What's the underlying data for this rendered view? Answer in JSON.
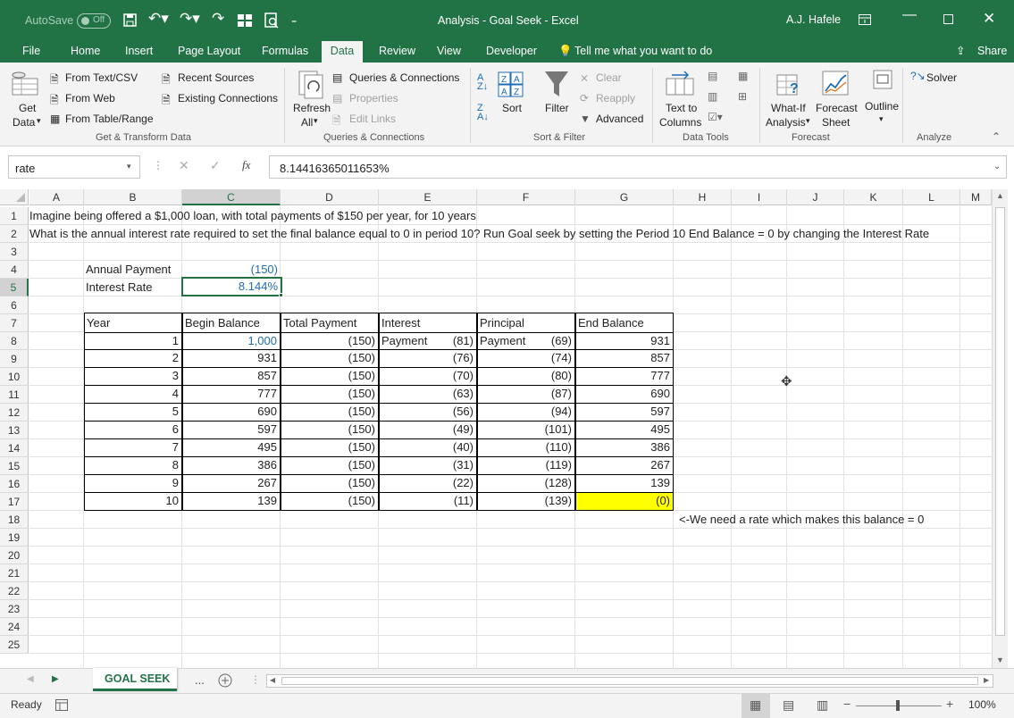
{
  "window": {
    "autosave": "AutoSave",
    "autosave_state": "Off",
    "title": "Analysis - Goal Seek  -  Excel",
    "user": "A.J. Hafele"
  },
  "tabs": [
    "File",
    "Home",
    "Insert",
    "Page Layout",
    "Formulas",
    "Data",
    "Review",
    "View",
    "Developer"
  ],
  "tell_me": "Tell me what you want to do",
  "share": "Share",
  "ribbon": {
    "get_data": "Get",
    "get_data2": "Data",
    "from_text": "From Text/CSV",
    "from_web": "From Web",
    "from_table": "From Table/Range",
    "recent_sources": "Recent Sources",
    "existing_connections": "Existing Connections",
    "refresh": "Refresh",
    "refresh2": "All",
    "queries": "Queries & Connections",
    "properties": "Properties",
    "edit_links": "Edit Links",
    "sort": "Sort",
    "filter": "Filter",
    "clear": "Clear",
    "reapply": "Reapply",
    "advanced": "Advanced",
    "text_to_columns": "Text to",
    "text_to_columns2": "Columns",
    "whatif": "What-If",
    "whatif2": "Analysis",
    "forecast": "Forecast",
    "forecast2": "Sheet",
    "outline": "Outline",
    "solver": "Solver",
    "groups": {
      "get_transform": "Get & Transform Data",
      "queries": "Queries & Connections",
      "sort_filter": "Sort & Filter",
      "data_tools": "Data Tools",
      "forecast": "Forecast",
      "analyze": "Analyze"
    }
  },
  "namebox": "rate",
  "formula": "8.14416365011653%",
  "columns": [
    "A",
    "B",
    "C",
    "D",
    "E",
    "F",
    "G",
    "H",
    "I",
    "J",
    "K",
    "L",
    "M"
  ],
  "rows": [
    "1",
    "2",
    "3",
    "4",
    "5",
    "6",
    "7",
    "8",
    "9",
    "10",
    "11",
    "12",
    "13",
    "14",
    "15",
    "16",
    "17",
    "18",
    "19",
    "20",
    "21",
    "22",
    "23",
    "24",
    "25"
  ],
  "sheet": {
    "line1": "Imagine being offered a $1,000 loan, with total payments of $150 per year, for 10 years",
    "line2": "What is the annual interest rate required to set the final balance equal to 0 in period 10?  Run Goal seek by setting the Period 10 End Balance = 0 by changing the Interest Rate",
    "annual_payment_label": "Annual Payment",
    "annual_payment": "(150)",
    "interest_rate_label": "Interest Rate",
    "interest_rate": "8.144%",
    "headers": [
      "Year",
      "Begin Balance",
      "Total Payment",
      "Interest",
      "Principal",
      "End Balance"
    ],
    "headers2": [
      "",
      "",
      "",
      "Payment",
      "Payment",
      ""
    ],
    "table": [
      [
        "1",
        "1,000",
        "(150)",
        "(81)",
        "(69)",
        "931"
      ],
      [
        "2",
        "931",
        "(150)",
        "(76)",
        "(74)",
        "857"
      ],
      [
        "3",
        "857",
        "(150)",
        "(70)",
        "(80)",
        "777"
      ],
      [
        "4",
        "777",
        "(150)",
        "(63)",
        "(87)",
        "690"
      ],
      [
        "5",
        "690",
        "(150)",
        "(56)",
        "(94)",
        "597"
      ],
      [
        "6",
        "597",
        "(150)",
        "(49)",
        "(101)",
        "495"
      ],
      [
        "7",
        "495",
        "(150)",
        "(40)",
        "(110)",
        "386"
      ],
      [
        "8",
        "386",
        "(150)",
        "(31)",
        "(119)",
        "267"
      ],
      [
        "9",
        "267",
        "(150)",
        "(22)",
        "(128)",
        "139"
      ],
      [
        "10",
        "139",
        "(150)",
        "(11)",
        "(139)",
        "(0)"
      ]
    ],
    "note": "<-We need a rate which makes this balance = 0"
  },
  "sheet_tab": "GOAL SEEK",
  "ellipsis": "...",
  "status": "Ready",
  "zoom": "100%",
  "colors": {
    "excel_green": "#217346",
    "highlight": "#ffff00",
    "blue_text": "#1f6cb4"
  }
}
